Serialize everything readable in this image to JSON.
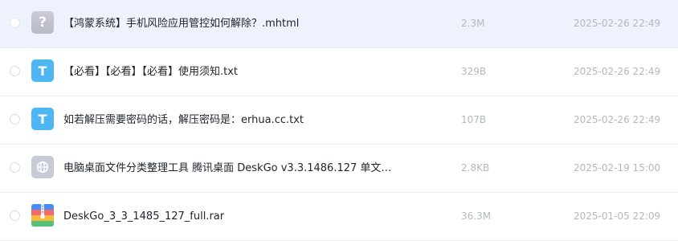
{
  "files": [
    {
      "name": "【鸿蒙系统】手机风险应用管控如何解除？.mhtml",
      "size": "2.3M",
      "date": "2025-02-26 22:49",
      "icon": "unknown-file-icon",
      "icon_glyph": "?",
      "selected": true
    },
    {
      "name": "【必看】【必看】【必看】使用须知.txt",
      "size": "329B",
      "date": "2025-02-26 22:49",
      "icon": "txt-file-icon",
      "icon_glyph": "T",
      "selected": false
    },
    {
      "name": "如若解压需要密码的话，解压密码是：erhua.cc.txt",
      "size": "107B",
      "date": "2025-02-26 22:49",
      "icon": "txt-file-icon",
      "icon_glyph": "T",
      "selected": false
    },
    {
      "name": "电脑桌面文件分类整理工具 腾讯桌面 DeskGo v3.3.1486.127 单文件…",
      "size": "2.8KB",
      "date": "2025-02-19 15:00",
      "icon": "web-file-icon",
      "icon_glyph": "",
      "selected": false
    },
    {
      "name": "DeskGo_3_3_1485_127_full.rar",
      "size": "36.3M",
      "date": "2025-01-05 22:09",
      "icon": "rar-file-icon",
      "icon_glyph": "",
      "selected": false
    }
  ],
  "colors": {
    "selected_row_bg": "#eef2fd",
    "txt_icon": "#4fb6f4",
    "unknown_icon": "#c0c4cf",
    "meta_text": "#b3b7c0",
    "name_text": "#1f2329"
  }
}
